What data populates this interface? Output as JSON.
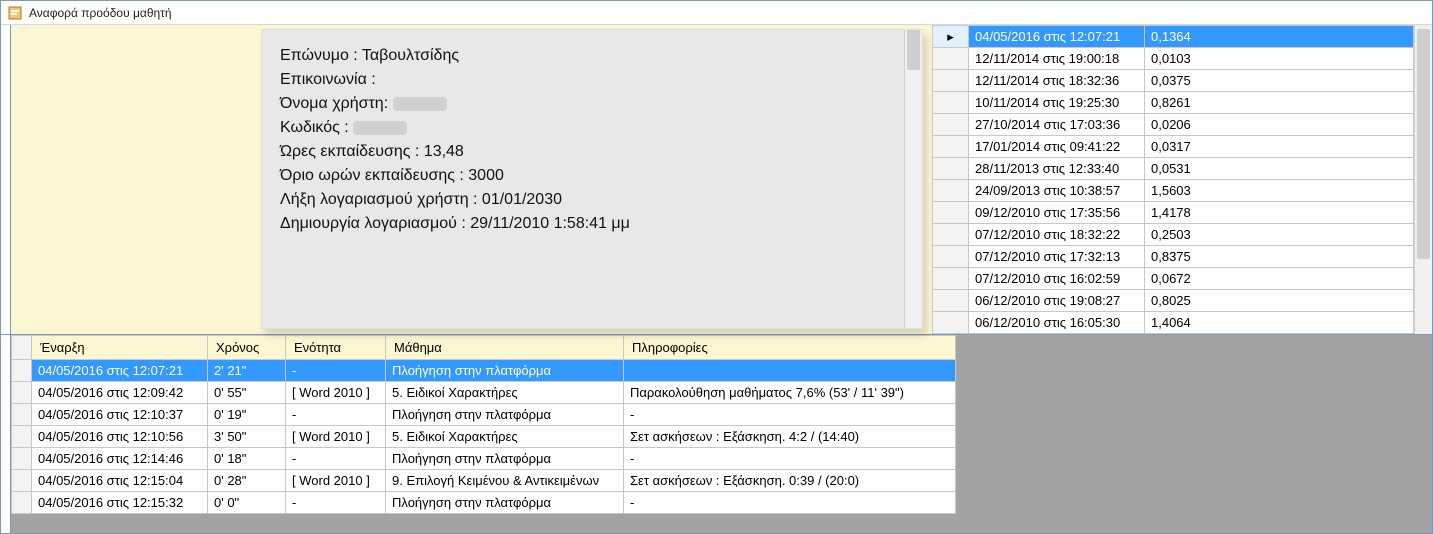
{
  "window": {
    "title": "Αναφορά προόδου μαθητή"
  },
  "info": {
    "line0_label": "Επώνυμο : ",
    "line0_value": "Ταβουλτσίδης",
    "line1_label": "Επικοινωνία :",
    "line1_value": "",
    "line2_label": "Όνομα χρήστη: ",
    "line2_redacted": true,
    "line3_label": "Κωδικός : ",
    "line3_redacted": true,
    "line4": "Ώρες εκπαίδευσης : 13,48",
    "line5": "Όριο ωρών εκπαίδευσης : 3000",
    "line6": "Λήξη λογαριασμού χρήστη : 01/01/2030",
    "line7": "Δημιουργία λογαριασμού : 29/11/2010 1:58:41 μμ"
  },
  "sessions": [
    {
      "ts": "04/05/2016 στις 12:07:21",
      "v": "0,1364"
    },
    {
      "ts": "12/11/2014 στις 19:00:18",
      "v": "0,0103"
    },
    {
      "ts": "12/11/2014 στις 18:32:36",
      "v": "0,0375"
    },
    {
      "ts": "10/11/2014 στις 19:25:30",
      "v": "0,8261"
    },
    {
      "ts": "27/10/2014 στις 17:03:36",
      "v": "0,0206"
    },
    {
      "ts": "17/01/2014 στις 09:41:22",
      "v": "0,0317"
    },
    {
      "ts": "28/11/2013 στις 12:33:40",
      "v": "0,0531"
    },
    {
      "ts": "24/09/2013 στις 10:38:57",
      "v": "1,5603"
    },
    {
      "ts": "09/12/2010 στις 17:35:56",
      "v": "1,4178"
    },
    {
      "ts": "07/12/2010 στις 18:32:22",
      "v": "0,2503"
    },
    {
      "ts": "07/12/2010 στις 17:32:13",
      "v": "0,8375"
    },
    {
      "ts": "07/12/2010 στις 16:02:59",
      "v": "0,0672"
    },
    {
      "ts": "06/12/2010 στις 19:08:27",
      "v": "0,8025"
    },
    {
      "ts": "06/12/2010 στις 16:05:30",
      "v": "1,4064"
    }
  ],
  "sessions_selected": 0,
  "activity_headers": {
    "start": "Έναρξη",
    "time": "Χρόνος",
    "unit": "Ενότητα",
    "lesson": "Μάθημα",
    "info": "Πληροφορίες"
  },
  "activity_rows": [
    {
      "start": "04/05/2016 στις 12:07:21",
      "time": "2' 21\"",
      "unit": "-",
      "lesson": "Πλοήγηση στην πλατφόρμα",
      "info": ""
    },
    {
      "start": "04/05/2016 στις 12:09:42",
      "time": "0' 55\"",
      "unit": "[ Word 2010 ]",
      "lesson": "5. Ειδικοί Χαρακτήρες",
      "info": "Παρακολούθηση μαθήματος 7,6% (53' / 11' 39\")"
    },
    {
      "start": "04/05/2016 στις 12:10:37",
      "time": "0' 19\"",
      "unit": "-",
      "lesson": "Πλοήγηση στην πλατφόρμα",
      "info": "-"
    },
    {
      "start": "04/05/2016 στις 12:10:56",
      "time": "3' 50\"",
      "unit": "[ Word 2010 ]",
      "lesson": "5. Ειδικοί Χαρακτήρες",
      "info": "Σετ ασκήσεων : Εξάσκηση. 4:2 / (14:40)"
    },
    {
      "start": "04/05/2016 στις 12:14:46",
      "time": "0' 18\"",
      "unit": "-",
      "lesson": "Πλοήγηση στην πλατφόρμα",
      "info": "-"
    },
    {
      "start": "04/05/2016 στις 12:15:04",
      "time": "0' 28\"",
      "unit": "[ Word 2010 ]",
      "lesson": "9. Επιλογή Κειμένου & Αντικειμένων",
      "info": "Σετ ασκήσεων : Εξάσκηση. 0:39 / (20:0)"
    },
    {
      "start": "04/05/2016 στις 12:15:32",
      "time": "0' 0\"",
      "unit": "-",
      "lesson": "Πλοήγηση στην πλατφόρμα",
      "info": "-"
    }
  ],
  "activity_selected": 0
}
